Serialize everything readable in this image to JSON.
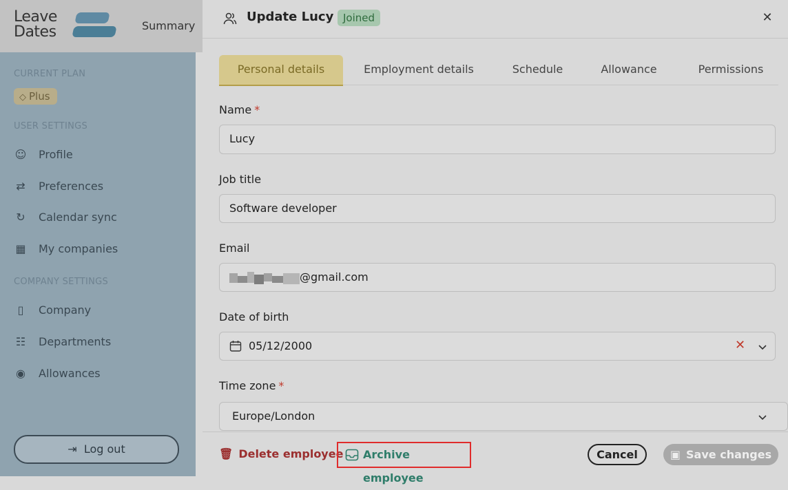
{
  "app": {
    "logo_line1": "Leave",
    "logo_line2": "Dates",
    "nav_summary": "Summary"
  },
  "sidebar": {
    "current_plan_label": "CURRENT PLAN",
    "plan_name": "Plus",
    "user_settings_label": "USER SETTINGS",
    "company_settings_label": "COMPANY SETTINGS",
    "items": [
      {
        "label": "Profile",
        "icon": "user-icon"
      },
      {
        "label": "Preferences",
        "icon": "sliders-icon"
      },
      {
        "label": "Calendar sync",
        "icon": "sync-icon"
      },
      {
        "label": "My companies",
        "icon": "buildings-icon"
      },
      {
        "label": "Company",
        "icon": "building-icon"
      },
      {
        "label": "Departments",
        "icon": "sitemap-icon"
      },
      {
        "label": "Allowances",
        "icon": "piggy-bank-icon"
      }
    ],
    "logout_label": "Log out"
  },
  "drawer": {
    "title": "Update Lucy",
    "status_badge": "Joined",
    "tabs": [
      "Personal details",
      "Employment details",
      "Schedule",
      "Allowance",
      "Permissions"
    ],
    "active_tab": "Personal details",
    "fields": {
      "name_label": "Name",
      "name_value": "Lucy",
      "job_title_label": "Job title",
      "job_title_value": "Software developer",
      "email_label": "Email",
      "email_domain": "@gmail.com",
      "dob_label": "Date of birth",
      "dob_value": "05/12/2000",
      "timezone_label": "Time zone",
      "timezone_value": "Europe/London",
      "required_mark": "*"
    },
    "footer": {
      "delete_label": "Delete employee",
      "archive_label": "Archive employee",
      "cancel_label": "Cancel",
      "save_label": "Save changes"
    }
  },
  "colors": {
    "accent_tab": "#d6c88c",
    "joined_badge": "#a7c7ae",
    "delete_red": "#9b2f2f",
    "archive_green": "#2f7d6a",
    "highlight_border": "#e02b2b"
  }
}
